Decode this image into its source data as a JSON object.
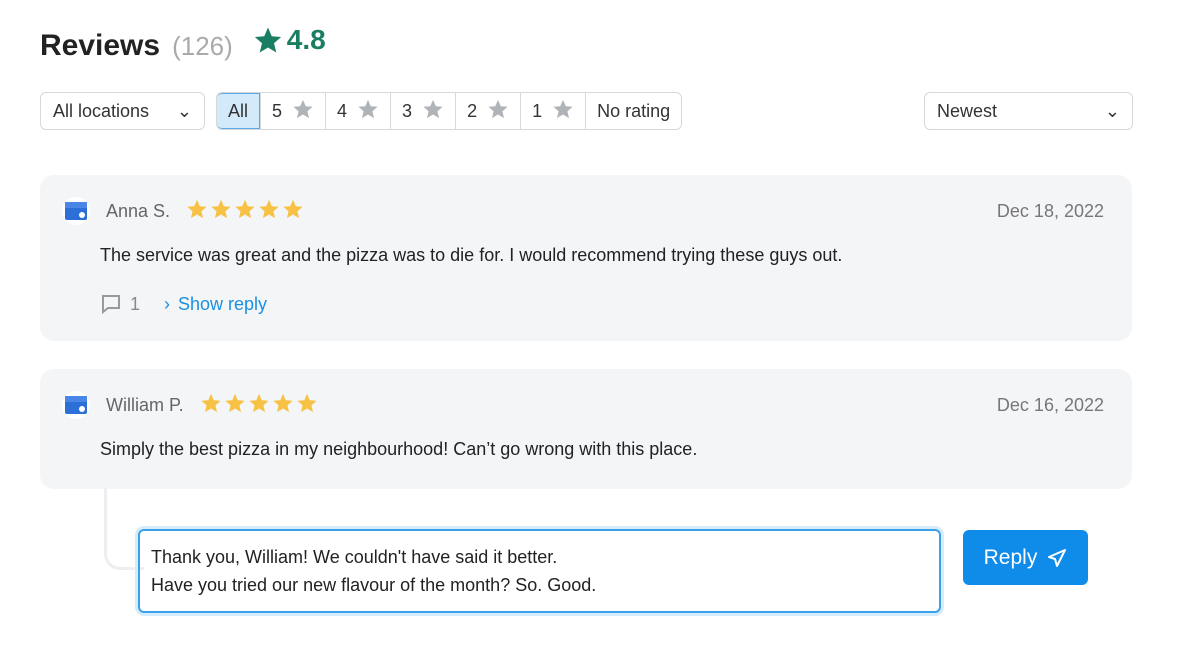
{
  "header": {
    "title": "Reviews",
    "count": "(126)",
    "rating": "4.8",
    "rating_icon": "star-icon",
    "rating_color": "#1a7f62"
  },
  "filters": {
    "location": "All locations",
    "ratings": [
      {
        "label": "All",
        "active": true
      },
      {
        "label": "5"
      },
      {
        "label": "4"
      },
      {
        "label": "3"
      },
      {
        "label": "2"
      },
      {
        "label": "1"
      },
      {
        "label": "No rating"
      }
    ],
    "sort": "Newest"
  },
  "reviews": [
    {
      "name": "Anna S.",
      "stars": 5,
      "date": "Dec 18, 2022",
      "text": "The service was great and the pizza was to die for. I would recommend trying these guys out.",
      "reply_count": "1",
      "show_reply": "Show reply"
    },
    {
      "name": "William P.",
      "stars": 5,
      "date": "Dec 16, 2022",
      "text": "Simply the best pizza in my neighbourhood! Can’t go wrong with this place."
    }
  ],
  "reply": {
    "value": "Thank you, William! We couldn't have said it better.\nHave you tried our new flavour of the month? So. Good.",
    "button": "Reply"
  },
  "colors": {
    "accent": "#0f8bea",
    "star": "#f7c244",
    "inactive_star": "#b0b3b8"
  }
}
